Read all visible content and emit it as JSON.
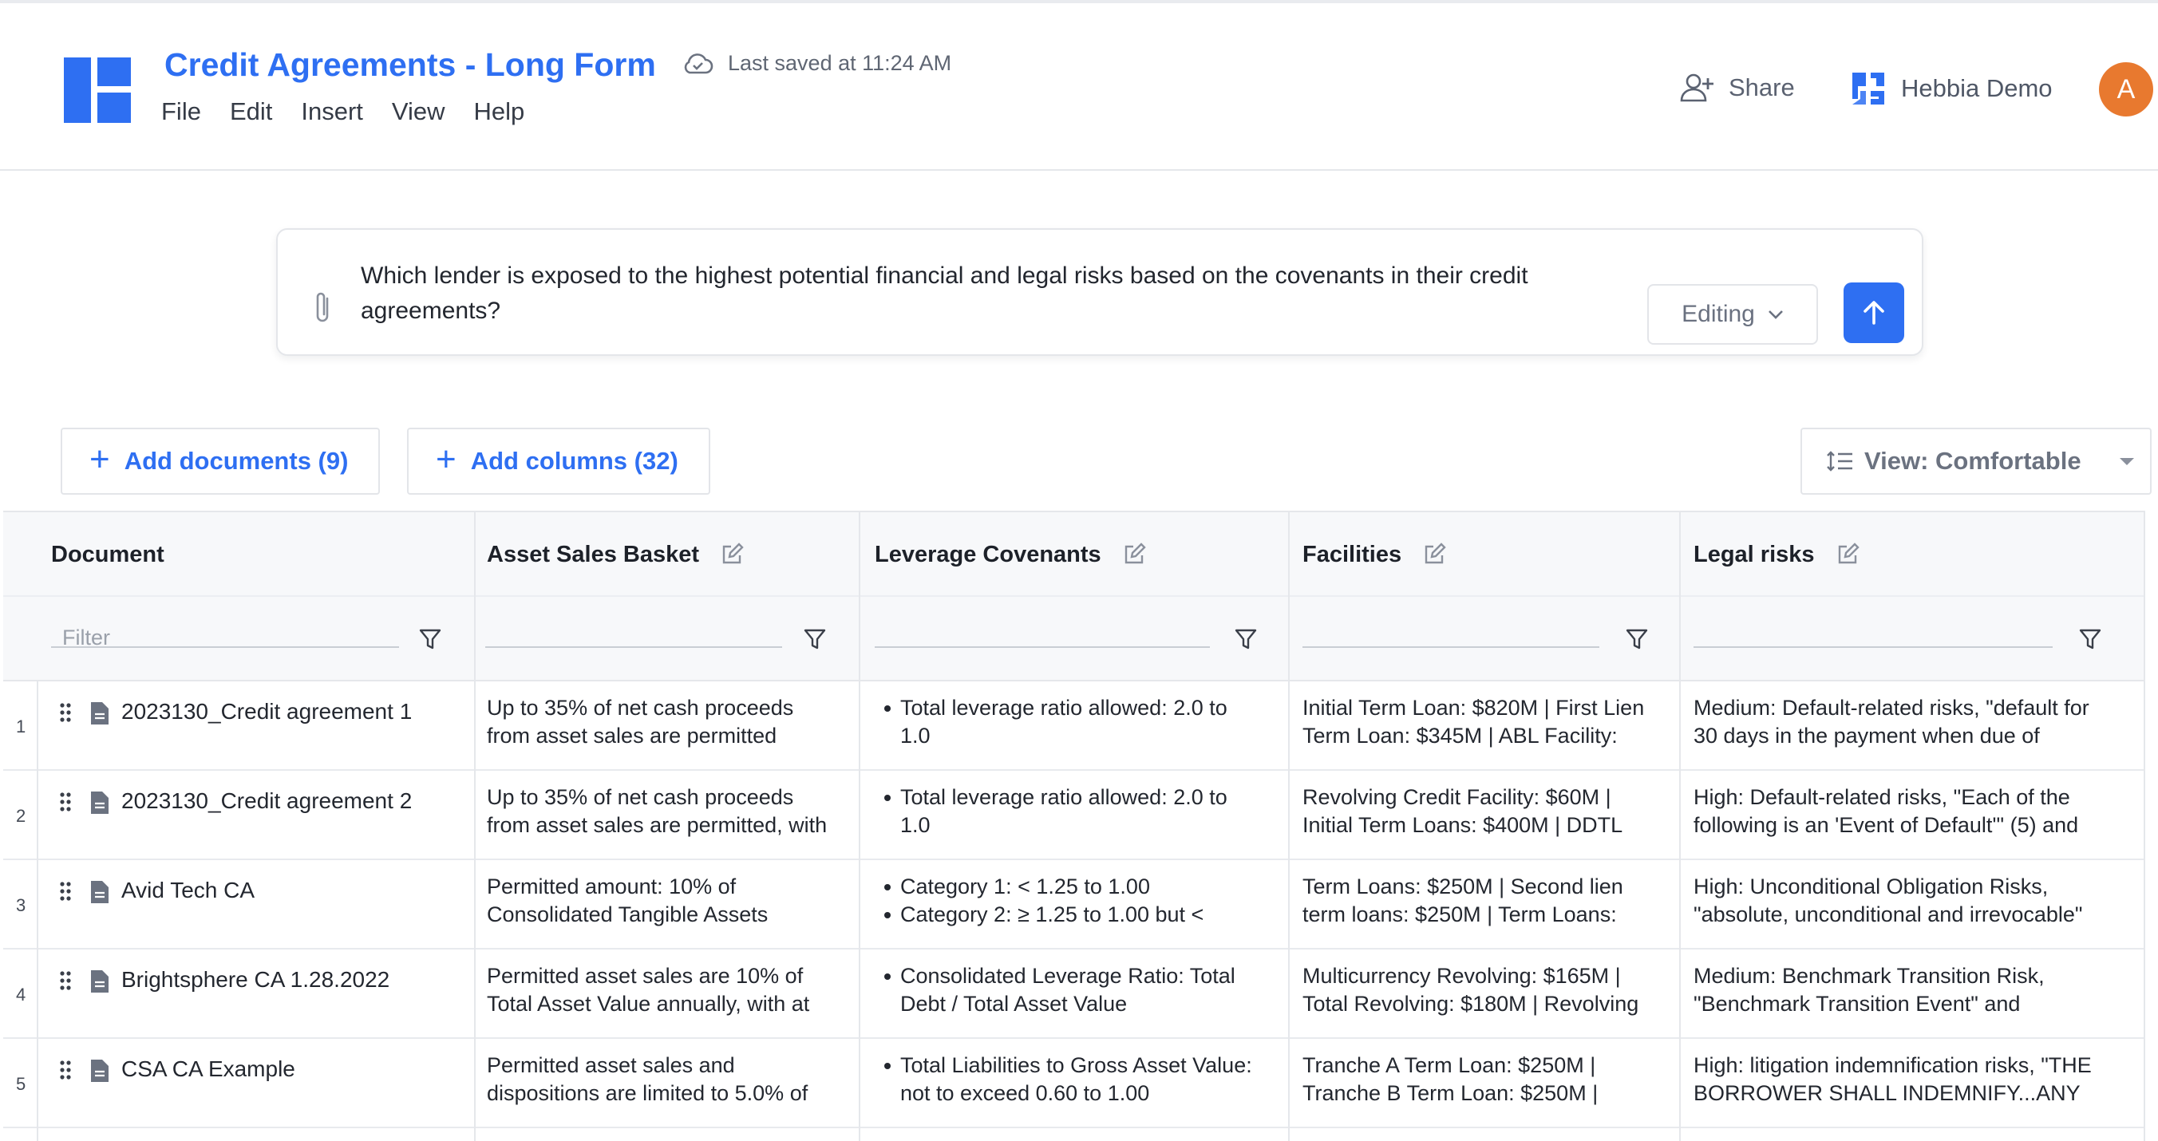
{
  "app": {
    "title": "Credit Agreements - Long Form",
    "saved_text": "Last saved at 11:24 AM",
    "menu": [
      "File",
      "Edit",
      "Insert",
      "View",
      "Help"
    ],
    "share_label": "Share",
    "org_name": "Hebbia Demo",
    "avatar_initial": "A",
    "accent": "#2e6ff2",
    "avatar_color": "#e8792f"
  },
  "query": {
    "line1": "Which lender is exposed to the highest potential financial and legal risks based on the covenants in their credit",
    "line2": "agreements?",
    "mode": "Editing"
  },
  "toolbar": {
    "add_documents": "Add documents (9)",
    "add_columns": "Add columns (32)",
    "view": "View: Comfortable"
  },
  "table": {
    "columns": [
      "Document",
      "Asset Sales Basket",
      "Leverage Covenants",
      "Facilities",
      "Legal risks"
    ],
    "filter_placeholder": "Filter",
    "rows": [
      {
        "num": "1",
        "document": "2023130_Credit agreement 1",
        "asset_sales": [
          "Up to 35% of net cash proceeds",
          "from asset sales are permitted"
        ],
        "leverage": [
          "Total leverage ratio allowed: 2.0 to",
          "1.0"
        ],
        "facilities": [
          "Initial Term Loan: $820M | First Lien",
          "Term Loan: $345M | ABL Facility:"
        ],
        "legal": [
          "Medium: Default-related risks, \"default for",
          "30 days in the payment when due of"
        ]
      },
      {
        "num": "2",
        "document": "2023130_Credit agreement 2",
        "asset_sales": [
          "Up to 35% of net cash proceeds",
          "from asset sales are permitted, with"
        ],
        "leverage": [
          "Total leverage ratio allowed: 2.0 to",
          "1.0"
        ],
        "facilities": [
          "Revolving Credit Facility: $60M |",
          "Initial Term Loans: $400M | DDTL"
        ],
        "legal": [
          "High: Default-related risks, \"Each of the",
          "following is an 'Event of Default'\" (5) and"
        ]
      },
      {
        "num": "3",
        "document": "Avid Tech CA",
        "asset_sales": [
          "Permitted amount: 10% of",
          "Consolidated Tangible Assets"
        ],
        "leverage": [
          "Category 1: < 1.25 to 1.00",
          "Category 2: ≥ 1.25 to 1.00 but <"
        ],
        "facilities": [
          "Term Loans: $250M | Second lien",
          "term loans: $250M | Term Loans:"
        ],
        "legal": [
          "High: Unconditional Obligation Risks,",
          "\"absolute, unconditional and irrevocable\""
        ]
      },
      {
        "num": "4",
        "document": "Brightsphere CA 1.28.2022",
        "asset_sales": [
          "Permitted asset sales are 10% of",
          "Total Asset Value annually, with at"
        ],
        "leverage": [
          "Consolidated Leverage Ratio: Total",
          "Debt / Total Asset Value"
        ],
        "facilities": [
          "Multicurrency Revolving: $165M |",
          "Total Revolving: $180M | Revolving"
        ],
        "legal": [
          "Medium: Benchmark Transition Risk,",
          "\"Benchmark Transition Event\" and"
        ]
      },
      {
        "num": "5",
        "document": "CSA CA Example",
        "asset_sales": [
          "Permitted asset sales and",
          "dispositions are limited to 5.0% of"
        ],
        "leverage": [
          "Total Liabilities to Gross Asset Value:",
          "not to exceed 0.60 to 1.00"
        ],
        "facilities": [
          "Tranche A Term Loan: $250M |",
          "Tranche B Term Loan: $250M |"
        ],
        "legal": [
          "High: litigation indemnification risks, \"THE",
          "BORROWER SHALL INDEMNIFY...ANY"
        ]
      }
    ]
  }
}
